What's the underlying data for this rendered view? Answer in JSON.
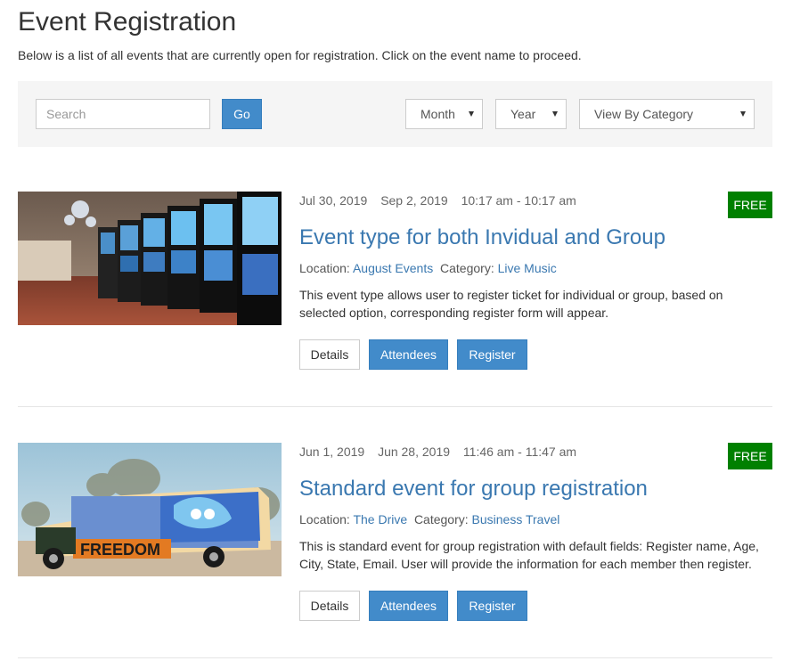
{
  "page": {
    "title": "Event Registration",
    "intro": "Below is a list of all events that are currently open for registration. Click on the event name to proceed."
  },
  "filters": {
    "search_placeholder": "Search",
    "go_label": "Go",
    "month_label": "Month",
    "year_label": "Year",
    "category_label": "View By Category"
  },
  "events": [
    {
      "start_date": "Jul 30, 2019",
      "end_date": "Sep 2, 2019",
      "time": "10:17 am - 10:17 am",
      "badge": "FREE",
      "title": "Event type for both Invidual and Group",
      "location_label": "Location:",
      "location": "August Events",
      "category_label": "Category:",
      "category": "Live Music",
      "description": "This event type allows user to register ticket for individual or group, based on selected option, corresponding register form will appear.",
      "details_label": "Details",
      "attendees_label": "Attendees",
      "register_label": "Register"
    },
    {
      "start_date": "Jun 1, 2019",
      "end_date": "Jun 28, 2019",
      "time": "11:46 am - 11:47 am",
      "badge": "FREE",
      "title": "Standard event for group registration",
      "location_label": "Location:",
      "location": "The Drive",
      "category_label": "Category:",
      "category": "Business Travel",
      "description": "This is standard event for group registration with default fields: Register name, Age, City, State, Email. User will provide the information for each member then register.",
      "details_label": "Details",
      "attendees_label": "Attendees",
      "register_label": "Register"
    }
  ],
  "colors": {
    "primary": "#428bca",
    "link": "#3a78b0",
    "free_badge": "#008000",
    "filter_bg": "#f5f5f5"
  }
}
